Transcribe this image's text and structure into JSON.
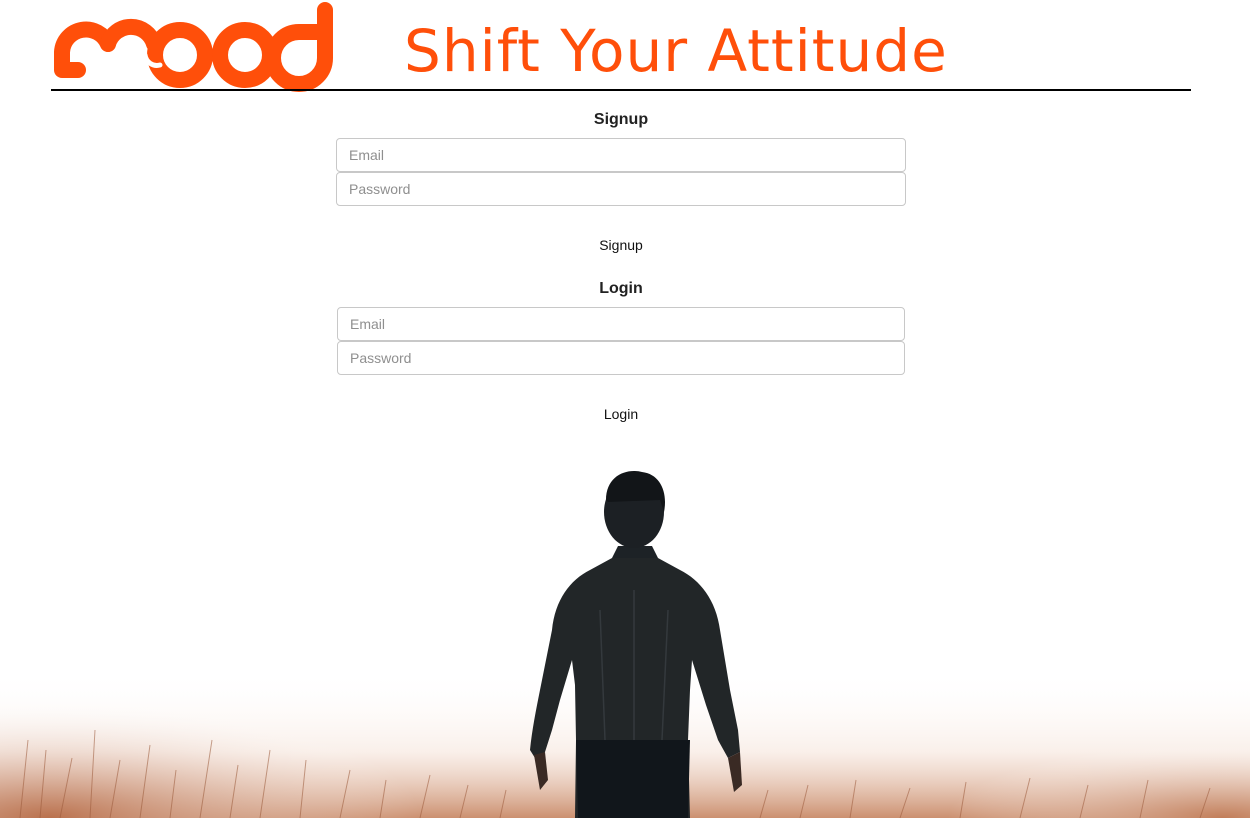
{
  "brand": {
    "logo_text": "mood",
    "tagline": "Shift Your Attitude",
    "accent_color": "#ff4f0a"
  },
  "signup": {
    "title": "Signup",
    "email_placeholder": "Email",
    "email_value": "",
    "password_placeholder": "Password",
    "password_value": "",
    "button_label": "Signup"
  },
  "login": {
    "title": "Login",
    "email_placeholder": "Email",
    "email_value": "",
    "password_placeholder": "Password",
    "password_value": "",
    "button_label": "Login"
  },
  "hero": {
    "image": "man-standing-in-fog-photo"
  }
}
